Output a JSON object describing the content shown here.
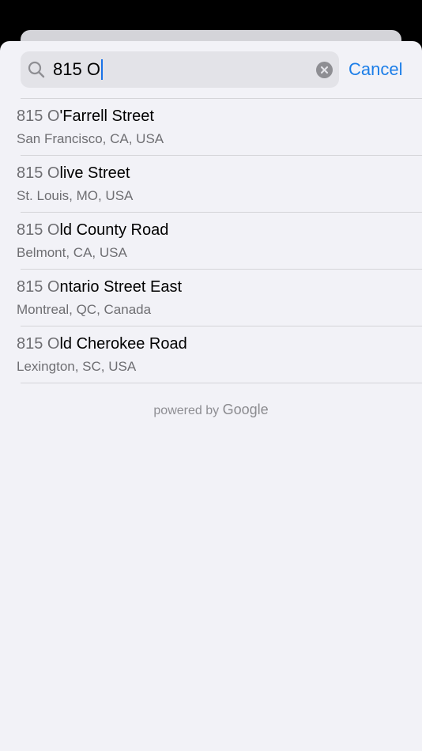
{
  "search": {
    "query": "815 O"
  },
  "cancel_label": "Cancel",
  "results": [
    {
      "match": "815 O",
      "rest": "'Farrell Street",
      "subtitle": "San Francisco, CA, USA"
    },
    {
      "match": "815 O",
      "rest": "live Street",
      "subtitle": "St. Louis, MO, USA"
    },
    {
      "match": "815 O",
      "rest": "ld County Road",
      "subtitle": "Belmont, CA, USA"
    },
    {
      "match": "815 O",
      "rest": "ntario Street East",
      "subtitle": "Montreal, QC, Canada"
    },
    {
      "match": "815 O",
      "rest": "ld Cherokee Road",
      "subtitle": "Lexington, SC, USA"
    }
  ],
  "attribution": {
    "prefix": "powered by",
    "brand": "Google"
  },
  "colors": {
    "accent": "#1c7ee8",
    "background": "#f2f2f7"
  }
}
